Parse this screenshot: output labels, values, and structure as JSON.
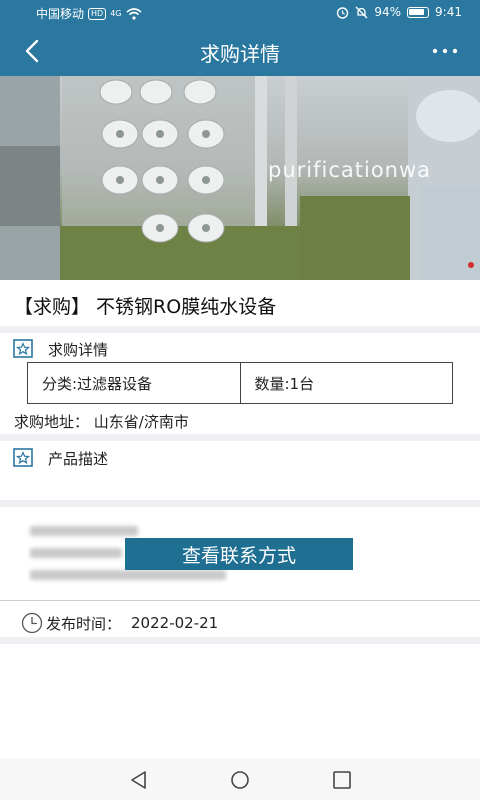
{
  "status_bar": {
    "carrier": "中国移动",
    "hd": "HD",
    "network": "4G",
    "battery": "94%",
    "time": "9:41"
  },
  "header": {
    "title": "求购详情"
  },
  "hero": {
    "watermark": "purificationwa"
  },
  "product": {
    "title": "【求购】 不锈钢RO膜纯水设备"
  },
  "detail_section": {
    "heading": "求购详情",
    "category": "分类:过滤器设备",
    "quantity": "数量:1台",
    "address": "求购地址： 山东省/济南市"
  },
  "description_section": {
    "heading": "产品描述"
  },
  "contact": {
    "button_label": "查看联系方式"
  },
  "publish": {
    "label": "发布时间：",
    "date": "2022-02-21"
  },
  "colors": {
    "header_bg": "#2a78a0",
    "button_bg": "#1f6f93",
    "divider": "#eff0f3"
  }
}
